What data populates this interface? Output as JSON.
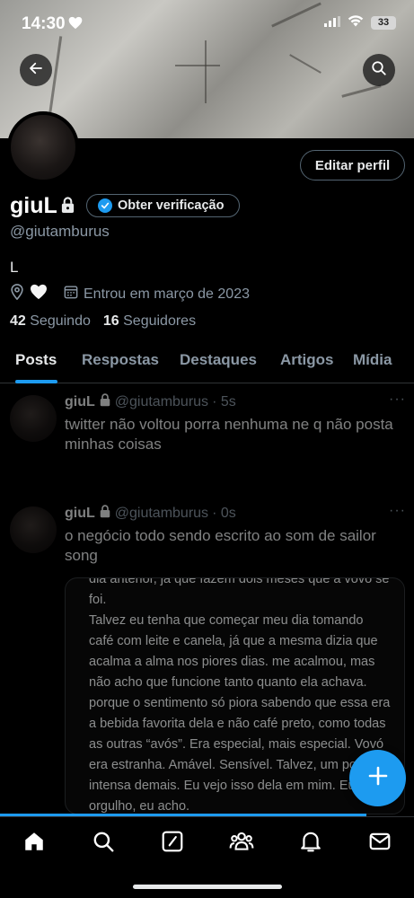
{
  "status_bar": {
    "time": "14:30",
    "battery": "33"
  },
  "profile": {
    "name": "giuL",
    "handle": "@giutamburus",
    "bio": "L",
    "joined": "Entrou em março de 2023",
    "following_count": "42",
    "following_label": "Seguindo",
    "followers_count": "16",
    "followers_label": "Seguidores",
    "edit_label": "Editar perfil",
    "verify_label": "Obter verificação"
  },
  "tabs": [
    {
      "label": "Posts",
      "active": true
    },
    {
      "label": "Respostas"
    },
    {
      "label": "Destaques"
    },
    {
      "label": "Artigos"
    },
    {
      "label": "Mídia"
    }
  ],
  "posts": [
    {
      "name": "giuL",
      "handle": "@giutamburus",
      "time": "· 5s",
      "text": "twitter não voltou porra nenhuma ne q não posta minhas coisas"
    },
    {
      "name": "giuL",
      "handle": "@giutamburus",
      "time": "· 0s",
      "text": "o negócio todo sendo escrito ao som de sailor song",
      "media_text": "dia anterior, já que fazem dois meses que a vovó se foi.\n Talvez eu tenha que começar meu dia tomando café com leite e canela, já que a mesma dizia que acalma a alma nos piores dias. me acalmou, mas não acho que funcione tanto quanto ela achava. porque o sentimento só piora sabendo que essa era a bebida favorita dela e não café preto, como todas as outras “avós”. Era especial, mais especial. Vovó era estranha. Amável. Sensível. Talvez, um pouco intensa demais. Eu vejo isso dela em mim. Eu me orgulho, eu acho."
    }
  ],
  "colors": {
    "accent": "#1d9bf0",
    "background": "#000000",
    "secondary_text": "#8b98a5"
  },
  "icons": [
    "back-arrow-icon",
    "search-icon",
    "lock-icon",
    "verified-badge-icon",
    "location-icon",
    "heart-icon",
    "calendar-icon",
    "plus-icon",
    "home-icon",
    "compose-icon",
    "communities-icon",
    "bell-icon",
    "mail-icon"
  ]
}
